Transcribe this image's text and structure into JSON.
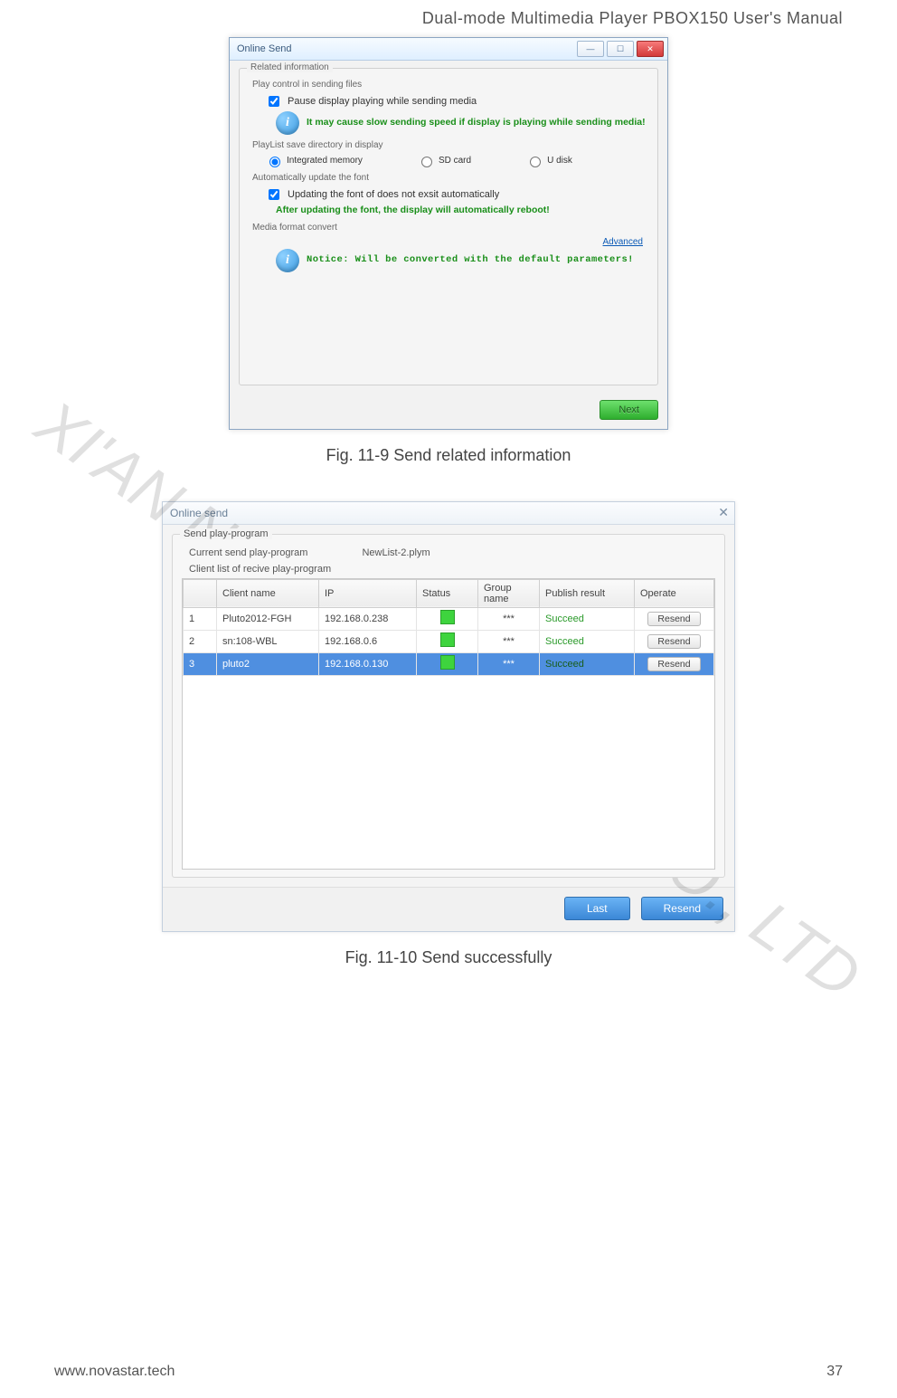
{
  "doc": {
    "header_title": "Dual-mode Multimedia Player PBOX150 User's Manual",
    "fig1_caption": "Fig. 11-9 Send related information",
    "fig2_caption": "Fig. 11-10 Send successfully",
    "footer_left": "www.novastar.tech",
    "footer_right": "37",
    "watermark": "XI'AN NOVASTAR TECH CO., LTD"
  },
  "win1": {
    "title": "Online Send",
    "group_related": "Related information",
    "sec_play_control": "Play control in sending files",
    "chk_pause": "Pause display playing while sending media",
    "warn_pause": "It may cause slow sending speed if display is playing while sending media!",
    "sec_playlist_dir": "PlayList save directory in display",
    "radio_integrated": "Integrated memory",
    "radio_sd": "SD card",
    "radio_udisk": "U disk",
    "sec_auto_font": "Automatically update the font",
    "chk_font": "Updating the font of does not exsit automatically",
    "warn_font": "After updating the font, the display will automatically reboot!",
    "sec_media_convert": "Media format convert",
    "advanced": "Advanced",
    "notice_convert": "Notice: Will be converted with the default parameters!",
    "next_btn": "Next"
  },
  "win2": {
    "title": "Online send",
    "group_send": "Send play-program",
    "curr_label": "Current send play-program",
    "curr_value": "NewList-2.plym",
    "client_list_lbl": "Client list of recive play-program",
    "headers": {
      "idx": "",
      "client": "Client name",
      "ip": "IP",
      "status": "Status",
      "group": "Group name",
      "result": "Publish result",
      "operate": "Operate"
    },
    "rows": [
      {
        "n": "1",
        "client": "Pluto2012-FGH",
        "ip": "192.168.0.238",
        "group": "***",
        "result": "Succeed",
        "op": "Resend",
        "selected": false
      },
      {
        "n": "2",
        "client": "sn:108-WBL",
        "ip": "192.168.0.6",
        "group": "***",
        "result": "Succeed",
        "op": "Resend",
        "selected": false
      },
      {
        "n": "3",
        "client": "pluto2",
        "ip": "192.168.0.130",
        "group": "***",
        "result": "Succeed",
        "op": "Resend",
        "selected": true
      }
    ],
    "btn_last": "Last",
    "btn_resend": "Resend"
  }
}
